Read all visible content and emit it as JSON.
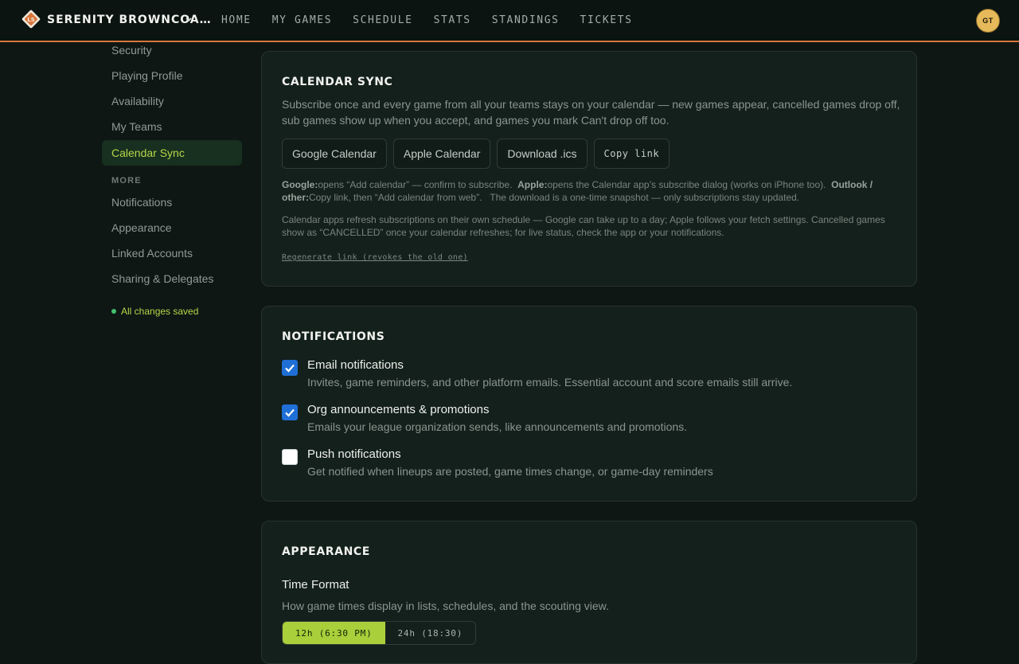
{
  "header": {
    "brand": "SERENITY BROWNCOA…",
    "logo_text": "LS",
    "nav": [
      "HOME",
      "MY GAMES",
      "SCHEDULE",
      "STATS",
      "STANDINGS",
      "TICKETS"
    ],
    "avatar_initials": "GT",
    "accent_color": "#d9753a"
  },
  "sidebar": {
    "items": [
      {
        "label": "Security"
      },
      {
        "label": "Playing Profile"
      },
      {
        "label": "Availability"
      },
      {
        "label": "My Teams"
      },
      {
        "label": "Calendar Sync",
        "active": true
      }
    ],
    "section_more": "MORE",
    "more_items": [
      {
        "label": "Notifications"
      },
      {
        "label": "Appearance"
      },
      {
        "label": "Linked Accounts"
      },
      {
        "label": "Sharing & Delegates"
      }
    ],
    "saved_status": "All changes saved"
  },
  "calendar_sync": {
    "title": "CALENDAR SYNC",
    "description": "Subscribe once and every game from all your teams stays on your calendar — new games appear, cancelled games drop off, sub games show up when you accept, and games you mark Can't drop off too.",
    "buttons": {
      "google": "Google Calendar",
      "apple": "Apple Calendar",
      "download": "Download .ics",
      "copy": "Copy link"
    },
    "help": {
      "google_label": "Google:",
      "google_text": "opens “Add calendar” — confirm to subscribe.",
      "apple_label": "Apple:",
      "apple_text": "opens the Calendar app’s subscribe dialog (works on iPhone too).",
      "outlook_label": "Outlook / other:",
      "outlook_text": "Copy link, then “Add calendar from web”.",
      "download_text": "The download is a one-time snapshot — only subscriptions stay updated."
    },
    "refresh_note": "Calendar apps refresh subscriptions on their own schedule — Google can take up to a day; Apple follows your fetch settings. Cancelled games show as “CANCELLED” once your calendar refreshes; for live status, check the app or your notifications.",
    "regenerate_link": "Regenerate link (revokes the old one)"
  },
  "notifications": {
    "title": "NOTIFICATIONS",
    "options": [
      {
        "label": "Email notifications",
        "desc": "Invites, game reminders, and other platform emails. Essential account and score emails still arrive.",
        "checked": true
      },
      {
        "label": "Org announcements & promotions",
        "desc": "Emails your league organization sends, like announcements and promotions.",
        "checked": true
      },
      {
        "label": "Push notifications",
        "desc": "Get notified when lineups are posted, game times change, or game-day reminders",
        "checked": false
      }
    ]
  },
  "appearance": {
    "title": "APPEARANCE",
    "time_format_label": "Time Format",
    "time_format_desc": "How game times display in lists, schedules, and the scouting view.",
    "options": [
      "12h (6:30 PM)",
      "24h (18:30)"
    ],
    "selected": "12h (6:30 PM)"
  }
}
